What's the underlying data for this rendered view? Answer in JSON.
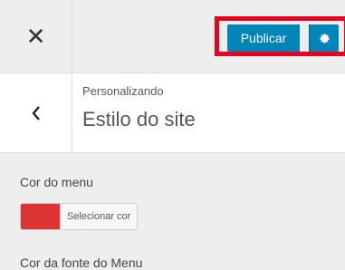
{
  "header": {
    "close_icon": "close-icon",
    "publish_label": "Publicar",
    "settings_icon": "gear-icon",
    "accent_color": "#0085ba",
    "highlight_color": "#e8001c"
  },
  "panel": {
    "back_icon": "chevron-left-icon",
    "context_label": "Personalizando",
    "section_title": "Estilo do site"
  },
  "controls": {
    "menu_color_label": "Cor do menu",
    "menu_color_value": "#dd3333",
    "select_color_label": "Selecionar cor",
    "menu_font_color_label": "Cor da fonte do Menu"
  }
}
